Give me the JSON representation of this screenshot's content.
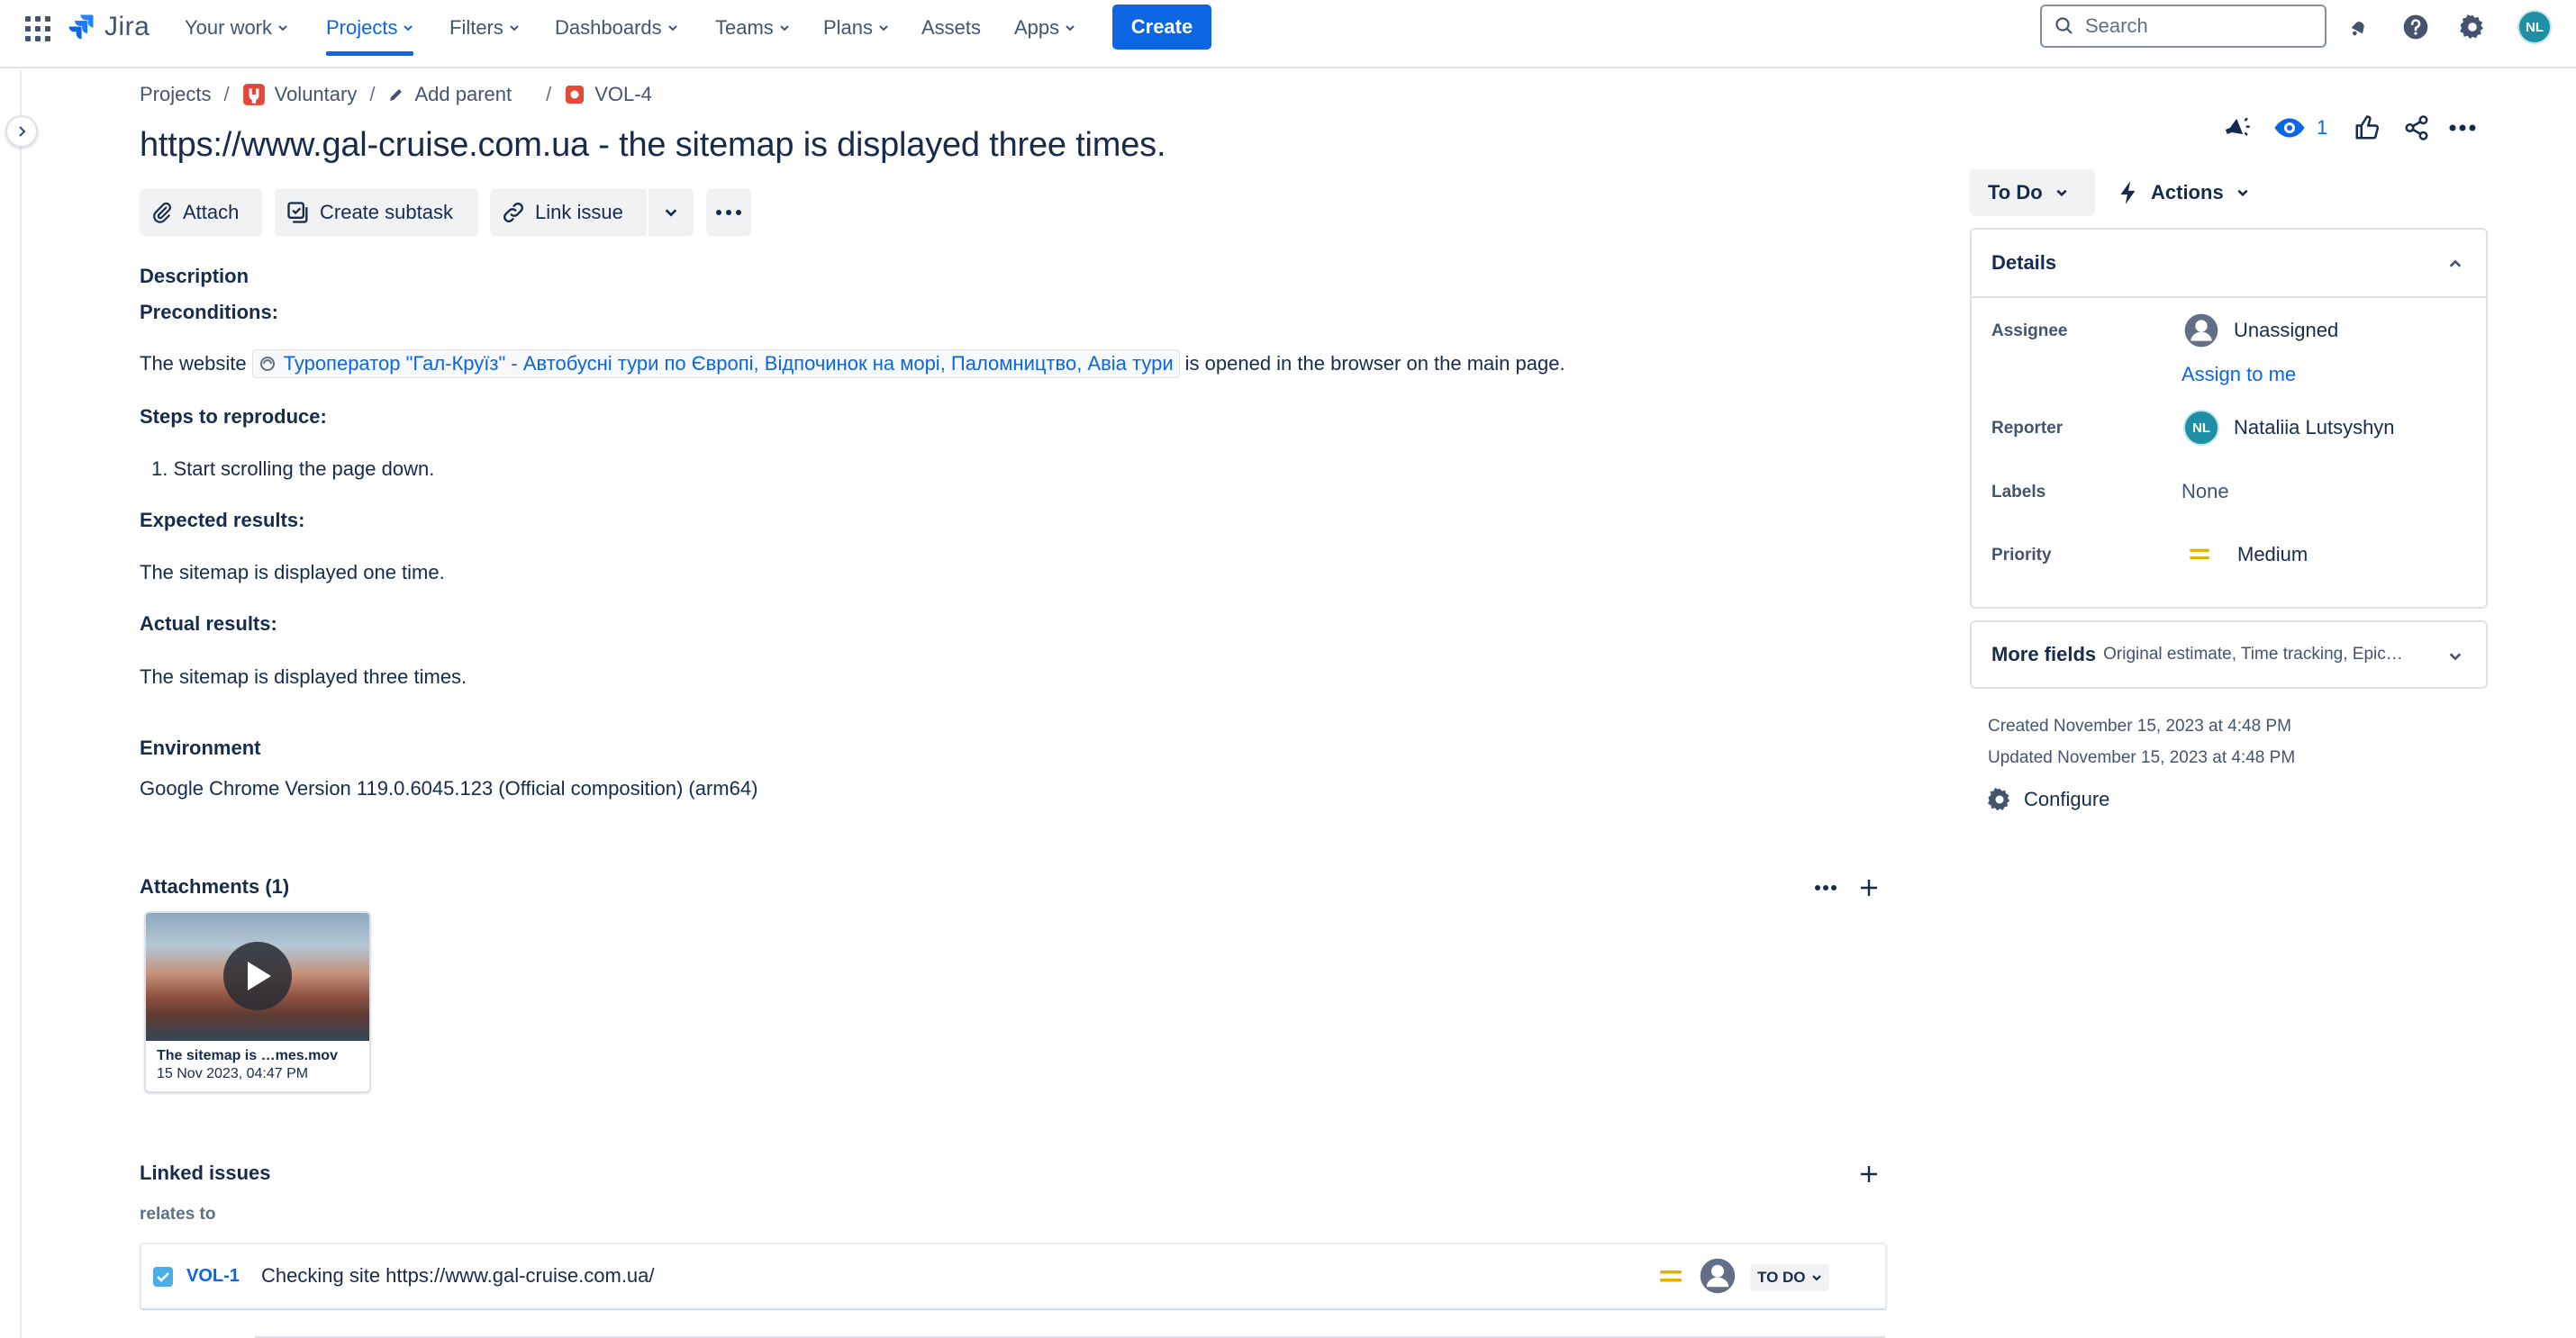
{
  "nav": {
    "product": "Jira",
    "items": [
      {
        "label": "Your work",
        "dropdown": true
      },
      {
        "label": "Projects",
        "dropdown": true,
        "active": true
      },
      {
        "label": "Filters",
        "dropdown": true
      },
      {
        "label": "Dashboards",
        "dropdown": true
      },
      {
        "label": "Teams",
        "dropdown": true
      },
      {
        "label": "Plans",
        "dropdown": true
      },
      {
        "label": "Assets",
        "dropdown": false
      },
      {
        "label": "Apps",
        "dropdown": true
      }
    ],
    "create_label": "Create",
    "search_placeholder": "Search",
    "user_initials": "NL"
  },
  "breadcrumb": {
    "projects": "Projects",
    "project": "Voluntary",
    "add_parent": "Add parent",
    "issue_key": "VOL-4"
  },
  "issue": {
    "title": "https://www.gal-cruise.com.ua - the sitemap is displayed three times.",
    "watchers": "1"
  },
  "toolbar": {
    "attach": "Attach",
    "create_subtask": "Create subtask",
    "link_issue": "Link issue"
  },
  "description": {
    "heading": "Description",
    "preconditions_h": "Preconditions:",
    "pre_before": "The website",
    "pre_link": "Туроператор \"Гал-Круїз\" - Автобусні тури по Європі, Відпочинок на морі, Паломництво, Авіа тури",
    "pre_after": "is opened in the browser on the main page.",
    "steps_h": "Steps to reproduce:",
    "steps": [
      "Start scrolling the page down."
    ],
    "expected_h": "Expected results:",
    "expected": "The sitemap is displayed one time.",
    "actual_h": "Actual results:",
    "actual": "The sitemap is displayed three times."
  },
  "environment": {
    "heading": "Environment",
    "value": "Google Chrome Version 119.0.6045.123 (Official composition) (arm64)"
  },
  "attachments": {
    "heading": "Attachments (1)",
    "items": [
      {
        "name": "The sitemap is …mes.mov",
        "date": "15 Nov 2023, 04:47 PM"
      }
    ]
  },
  "linked": {
    "heading": "Linked issues",
    "relation": "relates to",
    "items": [
      {
        "key": "VOL-1",
        "summary": "Checking site https://www.gal-cruise.com.ua/",
        "status": "TO DO"
      }
    ]
  },
  "status": {
    "current": "To Do",
    "actions": "Actions"
  },
  "details": {
    "heading": "Details",
    "assignee_label": "Assignee",
    "assignee": "Unassigned",
    "assign_to_me": "Assign to me",
    "reporter_label": "Reporter",
    "reporter": "Nataliia Lutsyshyn",
    "reporter_initials": "NL",
    "labels_label": "Labels",
    "labels": "None",
    "priority_label": "Priority",
    "priority": "Medium"
  },
  "more_fields": {
    "label": "More fields",
    "hint": "Original estimate, Time tracking, Epic…"
  },
  "meta": {
    "created": "Created November 15, 2023 at 4:48 PM",
    "updated": "Updated November 15, 2023 at 4:48 PM",
    "configure": "Configure"
  },
  "colors": {
    "brand": "#0c66e4",
    "priority_medium": "#e2b203",
    "text": "#172b4d",
    "subtle": "#44546f"
  }
}
